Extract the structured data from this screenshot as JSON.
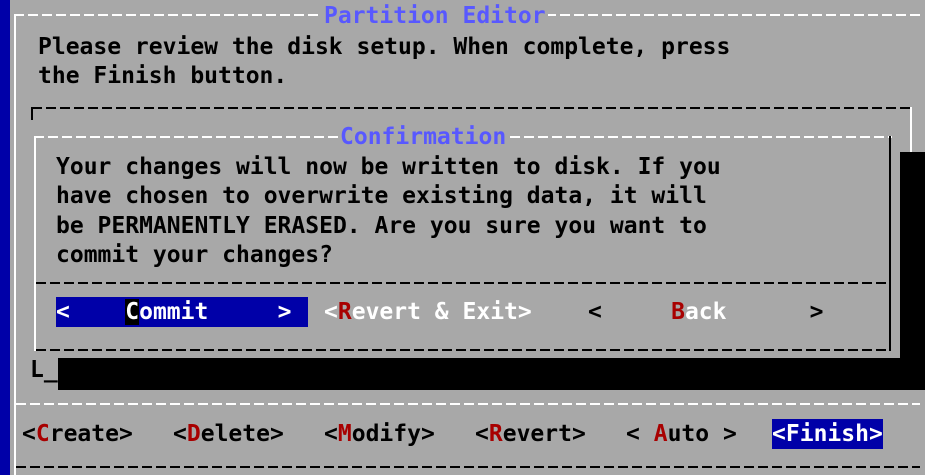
{
  "editor": {
    "title": "Partition Editor",
    "message_line1": "Please review the disk setup. When complete, press",
    "message_line2": "the Finish button.",
    "buttons": [
      {
        "hotkey": "C",
        "rest": "reate"
      },
      {
        "hotkey": "D",
        "rest": "elete"
      },
      {
        "hotkey": "M",
        "rest": "odify"
      },
      {
        "hotkey": "R",
        "rest": "evert"
      },
      {
        "hotkey": "A",
        "rest": "uto"
      },
      {
        "hotkey": "F",
        "rest": "inish"
      }
    ]
  },
  "dialog": {
    "title": "Confirmation",
    "text_lines": [
      "Your changes will now be written to disk. If you",
      "have chosen to overwrite existing data, it will",
      "be PERMANENTLY ERASED. Are you sure you want to",
      "commit your changes?"
    ],
    "buttons": [
      {
        "hotkey": "C",
        "rest": "ommit"
      },
      {
        "hotkey": "R",
        "rest": "evert & Exit"
      },
      {
        "hotkey": "B",
        "rest": "ack"
      }
    ]
  },
  "colors": {
    "background": "#0000a8",
    "window": "#a8a8a8",
    "title": "#5858ff",
    "hotkey": "#a80000",
    "selected": "#0000a8"
  }
}
